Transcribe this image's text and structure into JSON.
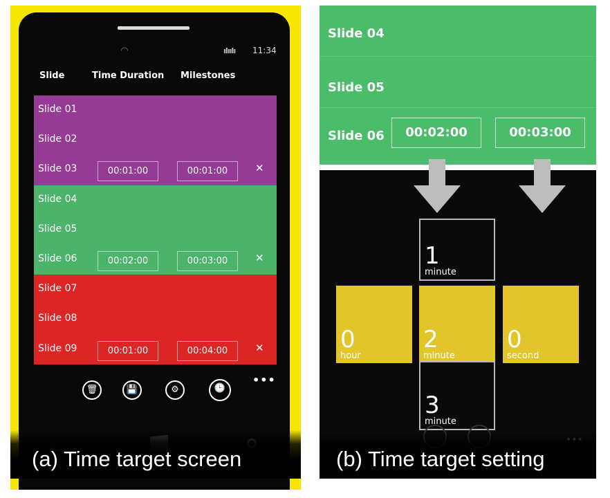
{
  "panel_a": {
    "status": {
      "signal": "◜◝",
      "battery": "ıIııIı",
      "time": "11:34"
    },
    "headers": {
      "slide": "Slide",
      "time_duration": "Time Duration",
      "milestones": "Milestones"
    },
    "rows": [
      {
        "label": "Slide 01",
        "color": "#963b95",
        "duration": "",
        "milestone": "",
        "remove": ""
      },
      {
        "label": "Slide 02",
        "color": "#963b95",
        "duration": "",
        "milestone": "",
        "remove": ""
      },
      {
        "label": "Slide 03",
        "color": "#963b95",
        "duration": "00:01:00",
        "milestone": "00:01:00",
        "remove": "✕"
      },
      {
        "label": "Slide 04",
        "color": "#4bb36a",
        "duration": "",
        "milestone": "",
        "remove": ""
      },
      {
        "label": "Slide 05",
        "color": "#4bb36a",
        "duration": "",
        "milestone": "",
        "remove": ""
      },
      {
        "label": "Slide 06",
        "color": "#4bb36a",
        "duration": "00:02:00",
        "milestone": "00:03:00",
        "remove": "✕"
      },
      {
        "label": "Slide 07",
        "color": "#de2525",
        "duration": "",
        "milestone": "",
        "remove": ""
      },
      {
        "label": "Slide 08",
        "color": "#de2525",
        "duration": "",
        "milestone": "",
        "remove": ""
      },
      {
        "label": "Slide 09",
        "color": "#de2525",
        "duration": "00:01:00",
        "milestone": "00:04:00",
        "remove": "✕"
      }
    ],
    "appbar": {
      "delete_icon": "🗑",
      "save_icon": "💾",
      "settings_icon": "⚙",
      "clock_icon": "🕒",
      "more": "•••"
    },
    "caption": "(a) Time target screen"
  },
  "panel_b": {
    "rows": [
      {
        "label": "Slide 04",
        "duration": "",
        "milestone": ""
      },
      {
        "label": "Slide 05",
        "duration": "",
        "milestone": ""
      },
      {
        "label": "Slide 06",
        "duration": "00:02:00",
        "milestone": "00:03:00"
      }
    ],
    "picker": {
      "above": {
        "value": "1",
        "unit": "minute"
      },
      "hour": {
        "value": "0",
        "unit": "hour"
      },
      "minute": {
        "value": "2",
        "unit": "minute"
      },
      "second": {
        "value": "0",
        "unit": "second"
      },
      "below": {
        "value": "3",
        "unit": "minute"
      }
    },
    "more": "•••",
    "caption": "(b) Time target setting"
  },
  "colors": {
    "frame_yellow": "#f7e600",
    "purple": "#963b95",
    "green": "#4bb36a",
    "red": "#de2525",
    "tile_yellow": "#e1c52b"
  }
}
